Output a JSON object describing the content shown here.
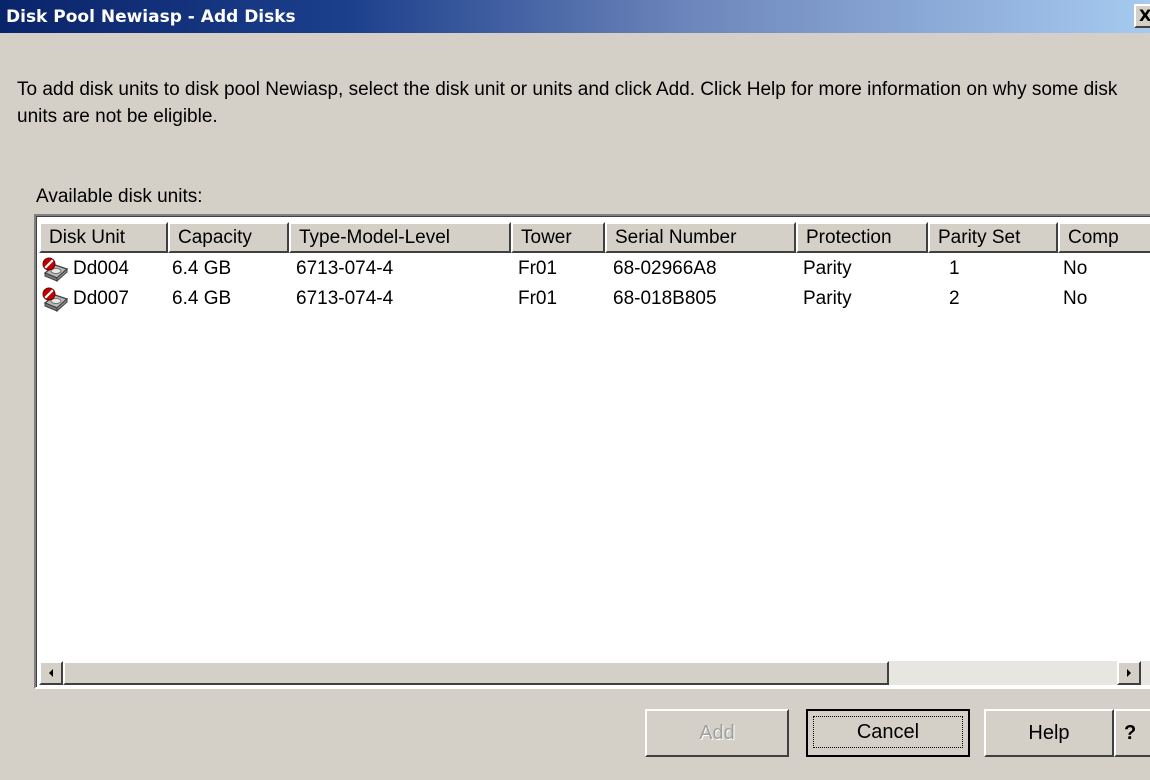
{
  "window": {
    "title": "Disk Pool Newiasp - Add Disks",
    "close_glyph": "X"
  },
  "instructions": "To add disk units to disk pool Newiasp, select the disk unit or units and click Add. Click Help for more information on why some disk units are not be eligible.",
  "list_label": "Available disk units:",
  "table": {
    "columns": [
      "Disk Unit",
      "Capacity",
      "Type-Model-Level",
      "Tower",
      "Serial Number",
      "Protection",
      "Parity Set",
      "Comp"
    ],
    "rows": [
      {
        "icon": "disk-unit-ineligible-icon",
        "cells": [
          "Dd004",
          "6.4 GB",
          "6713-074-4",
          "Fr01",
          "68-02966A8",
          "Parity",
          "1",
          "No"
        ]
      },
      {
        "icon": "disk-unit-ineligible-icon",
        "cells": [
          "Dd007",
          "6.4 GB",
          "6713-074-4",
          "Fr01",
          "68-018B805",
          "Parity",
          "2",
          "No"
        ]
      }
    ]
  },
  "buttons": {
    "add": "Add",
    "cancel": "Cancel",
    "help": "Help",
    "whats_this": "?"
  },
  "colors": {
    "titlebar_start": "#0a246a",
    "titlebar_end": "#a6caf0",
    "dialog_bg": "#d4d0c8",
    "ineligible_badge": "#c00000"
  }
}
